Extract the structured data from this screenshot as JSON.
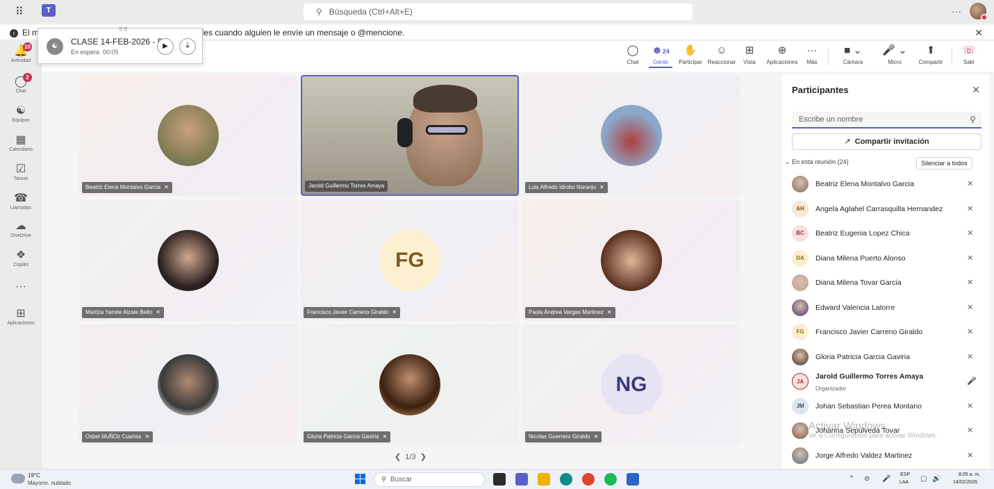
{
  "topbar": {
    "search_placeholder": "Búsqueda (Ctrl+Alt+E)",
    "more": "···"
  },
  "notification": {
    "text_before": "El m",
    "text_after": "ales cuando alguien le envíe un mensaje o @mencione."
  },
  "rail": {
    "items": [
      {
        "label": "Actividad",
        "icon": "bell-icon",
        "badge": "10"
      },
      {
        "label": "Chat",
        "icon": "chat-icon",
        "badge": "2"
      },
      {
        "label": "Equipos",
        "icon": "teams-icon"
      },
      {
        "label": "Calendario",
        "icon": "calendar-icon"
      },
      {
        "label": "Tareas",
        "icon": "tasks-icon"
      },
      {
        "label": "Llamadas",
        "icon": "phone-icon"
      },
      {
        "label": "OneDrive",
        "icon": "cloud-icon"
      },
      {
        "label": "Copilot",
        "icon": "copilot-icon"
      },
      {
        "label": "···",
        "icon": "more-icon"
      },
      {
        "label": "Aplicaciones",
        "icon": "apps-icon"
      }
    ]
  },
  "callcard": {
    "title": "CLASE 14-FEB-2026 - D",
    "status": "En espera",
    "timer": "00:05"
  },
  "toolbar": {
    "people_count": "24",
    "buttons": {
      "chat": "Chat",
      "people": "Gente",
      "raise": "Participar",
      "react": "Reaccionar",
      "view": "Vista",
      "apps": "Aplicaciones",
      "more": "Más",
      "camera": "Cámara",
      "mic": "Micro",
      "share": "Compartir",
      "leave": "Salir"
    }
  },
  "tiles": [
    {
      "name": "Beatriz Elena Montalvo Garcia",
      "type": "photo",
      "color": "#7a6a3a"
    },
    {
      "name": "Jarold Guillermo Torres Amaya",
      "type": "video"
    },
    {
      "name": "Luis Alfredo Idrobo Naranjo",
      "type": "photo",
      "color": "#8aa0b8"
    },
    {
      "name": "Maritza Yamile Alzate Bello",
      "type": "photo",
      "color": "#4a3a30"
    },
    {
      "name": "Francisco Javier Carreno Giraldo",
      "type": "initials",
      "initials": "FG"
    },
    {
      "name": "Paola Andrea Vargas Martinez",
      "type": "photo",
      "color": "#b0805a"
    },
    {
      "name": "Osbel MuÑOz Cuartas",
      "type": "photo",
      "color": "#6a6a6a"
    },
    {
      "name": "Gloria Patricia Garcia Gaviria",
      "type": "photo",
      "color": "#5a3a2a"
    },
    {
      "name": "Nicolas Guerrero Giraldo",
      "type": "initials",
      "initials": "NG"
    }
  ],
  "pager": {
    "text": "1/3"
  },
  "panel": {
    "title": "Participantes",
    "search_placeholder": "Escribe un nombre",
    "share_invite": "Compartir invitación",
    "section": "En esta reunión (24)",
    "mute_all": "Silenciar a todos",
    "participants": [
      {
        "name": "Beatriz Elena Montalvo Garcia",
        "avatar": "photo",
        "color": "#8a6a5a"
      },
      {
        "name": "Angela Aglahel Carrasquilla Hernandez",
        "initials": "AH",
        "bg": "#fbe7d3",
        "fg": "#8a4a1a"
      },
      {
        "name": "Beatriz Eugenia Lopez Chica",
        "initials": "BC",
        "bg": "#f8dede",
        "fg": "#a03030"
      },
      {
        "name": "Diana Milena Puerto Alonso",
        "initials": "DA",
        "bg": "#fdf0d0",
        "fg": "#8a6a1a"
      },
      {
        "name": "Diana Milena Tovar Garcia",
        "avatar": "photo",
        "color": "#c0a090"
      },
      {
        "name": "Edward Valencia Latorre",
        "avatar": "photo",
        "color": "#4a3a6a"
      },
      {
        "name": "Francisco Javier Carreno Giraldo",
        "initials": "FG",
        "bg": "#fdf0d0",
        "fg": "#8a6a1a"
      },
      {
        "name": "Gloria Patricia Garcia Gaviria",
        "avatar": "photo",
        "color": "#4a3020"
      },
      {
        "name": "Jarold Guillermo Torres Amaya",
        "initials": "JA",
        "bg": "#f8dede",
        "fg": "#a03030",
        "role": "Organizador",
        "organizer": true
      },
      {
        "name": "Johan Sebastian Perea Montano",
        "initials": "JM",
        "bg": "#dfe6ef",
        "fg": "#3a4a6a"
      },
      {
        "name": "Johanna Sepulveda Tovar",
        "avatar": "photo",
        "color": "#7a5a4a"
      },
      {
        "name": "Jorge Alfredo Valdez Martinez",
        "avatar": "photo",
        "color": "#5a6a7a"
      }
    ]
  },
  "watermark": {
    "line1": "Activar Windows",
    "line2": "Ve a Configuración para activar Windows."
  },
  "taskbar": {
    "temp": "19°C",
    "weather": "Mayorm. nublado",
    "search": "Buscar",
    "lang1": "ESP",
    "lang2": "LAA",
    "time": "8:05 a. m.",
    "date": "14/02/2026"
  }
}
